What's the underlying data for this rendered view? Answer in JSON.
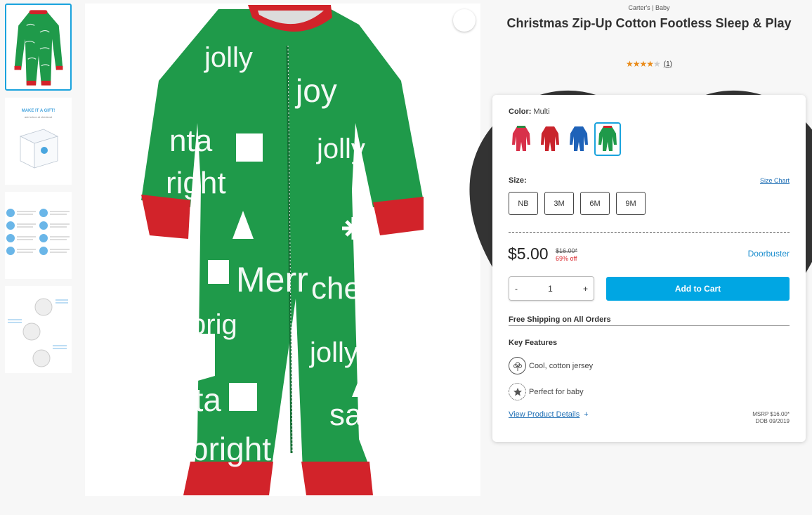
{
  "brand": "Carter's | Baby",
  "title": "Christmas Zip-Up Cotton Footless Sleep & Play",
  "rating": {
    "stars": 4,
    "max": 5,
    "count": "(1)"
  },
  "thumbnails": [
    {
      "label": ""
    },
    {
      "label": "MAKE IT A GIFT!",
      "sub": "add a box at checkout"
    },
    {
      "label": ""
    },
    {
      "label": ""
    }
  ],
  "color": {
    "label": "Color:",
    "value": "Multi",
    "swatches": [
      "#d8314a",
      "#c9242c",
      "#1e62b8",
      "#1f9a4a"
    ],
    "selected": 3
  },
  "size": {
    "label": "Size:",
    "chart_link": "Size Chart",
    "options": [
      "NB",
      "3M",
      "6M",
      "9M"
    ]
  },
  "price": {
    "current": "$5.00",
    "original": "$16.00*",
    "discount": "69% off",
    "deal": "Doorbuster"
  },
  "quantity": {
    "minus": "-",
    "value": "1",
    "plus": "+"
  },
  "add_to_cart": "Add to Cart",
  "shipping": "Free Shipping on All Orders",
  "key_features": {
    "title": "Key Features",
    "items": [
      {
        "icon": "cotton-icon",
        "text": "Cool, cotton jersey"
      },
      {
        "icon": "star-badge-icon",
        "text": "Perfect for baby"
      }
    ]
  },
  "details_link": "View Product Details",
  "details_plus": "+",
  "msrp": "MSRP $16.00*",
  "dob": "DOB 09/2019",
  "colors": {
    "accent": "#00a6e3",
    "selected_border": "#1aa3dd",
    "star": "#e98a18",
    "discount": "#d9262c",
    "garment_green": "#1f9a4a",
    "garment_red": "#d2232a"
  }
}
